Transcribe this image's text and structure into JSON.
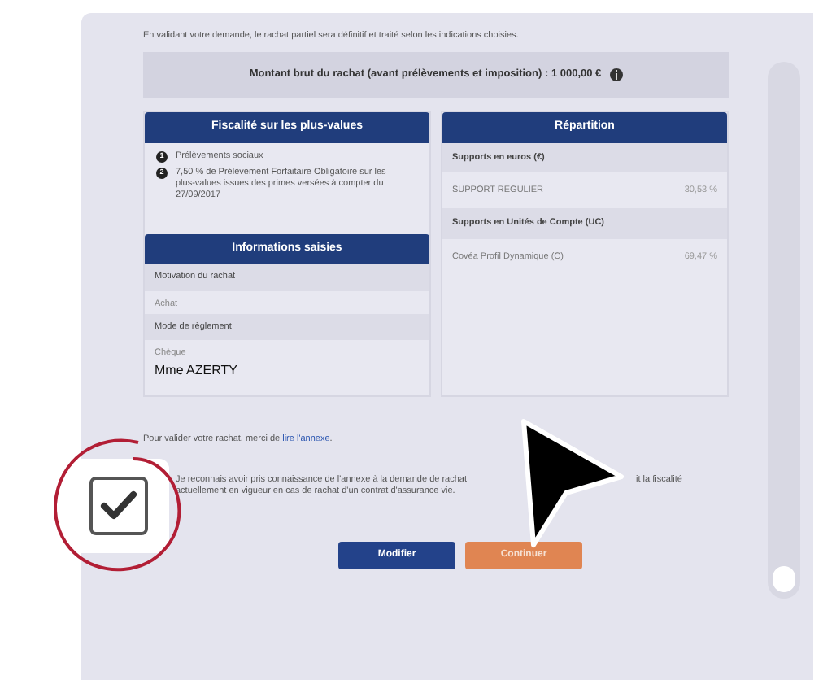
{
  "intro": "En validant votre demande, le rachat partiel sera définitif et traité selon les indications choisies.",
  "amount": {
    "text": "Montant brut du rachat (avant prélèvements et imposition) : 1 000,00 €"
  },
  "fiscalite": {
    "title": "Fiscalité sur les plus-values",
    "items": [
      {
        "number": "1",
        "text": "Prélèvements sociaux"
      },
      {
        "number": "2",
        "text": "7,50 % de Prélèvement Forfaitaire Obligatoire sur les plus-values issues des primes versées à compter du 27/09/2017"
      }
    ]
  },
  "informations": {
    "title": "Informations saisies",
    "rows": [
      {
        "kind": "label",
        "text": "Motivation du rachat"
      },
      {
        "kind": "value",
        "text": "Achat"
      },
      {
        "kind": "label",
        "text": "Mode de règlement"
      },
      {
        "kind": "value",
        "text": "Chèque"
      },
      {
        "kind": "name",
        "text": "Mme AZERTY"
      }
    ]
  },
  "repartition": {
    "title": "Répartition",
    "rows": [
      {
        "kind": "group",
        "label": "Supports en euros (€)"
      },
      {
        "kind": "line",
        "label": "SUPPORT REGULIER",
        "value": "30,53 %"
      },
      {
        "kind": "group",
        "label": "Supports en Unités de Compte (UC)"
      },
      {
        "kind": "line",
        "label": "Covéa Profil Dynamique (C)",
        "value": "69,47 %"
      }
    ]
  },
  "validation": {
    "text": "Pour valider votre rachat, merci de",
    "link": "lire l'annexe",
    "end": "."
  },
  "consent": {
    "checked": true,
    "line1_start": "Je reconnais avoir pris connaissance de l'annexe à la demande de rachat",
    "line1_end": "it la fiscalité",
    "line2": "actuellement en vigueur en cas de rachat d'un contrat d'assurance vie."
  },
  "buttons": [
    {
      "kind": "secondary",
      "label": "Modifier"
    },
    {
      "kind": "primary",
      "label": "Continuer"
    }
  ]
}
